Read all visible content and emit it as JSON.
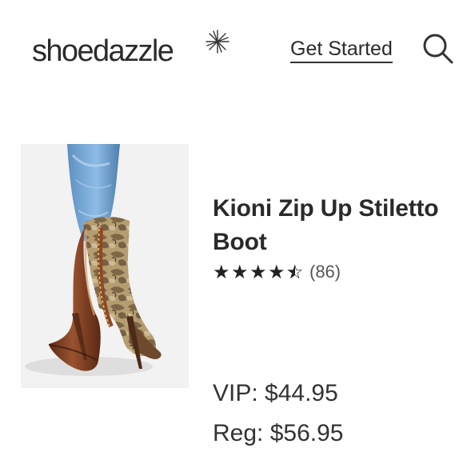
{
  "header": {
    "logo_text": "shoedazzle",
    "get_started_label": "Get Started",
    "search_icon": "search-icon"
  },
  "product": {
    "title": "Kioni Zip Up Stiletto Boot",
    "rating_value": 4.5,
    "rating_max": 5,
    "review_count": "(86)",
    "vip_price": "VIP: $44.95",
    "reg_price": "Reg: $56.95"
  },
  "colors": {
    "text": "#2b2b2b",
    "background": "#ffffff",
    "image_background": "#f2f2f2",
    "denim": "#6f9fcc",
    "boot_brown": "#7a3d1f",
    "snake_tan": "#b59d72"
  }
}
